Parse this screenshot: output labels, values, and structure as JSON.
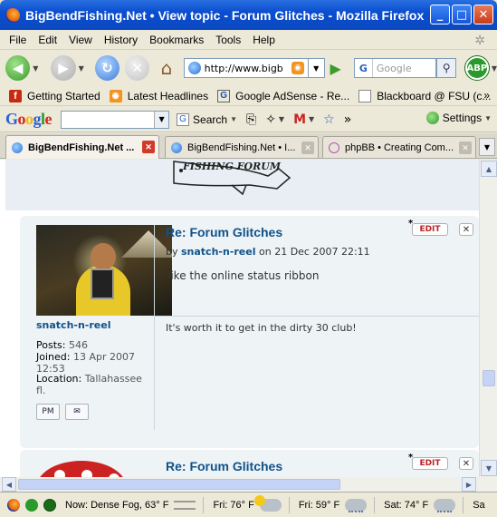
{
  "window": {
    "title": "BigBendFishing.Net • View topic - Forum Glitches - Mozilla Firefox",
    "buttons": [
      "_",
      "□",
      "✕"
    ]
  },
  "menu": [
    "File",
    "Edit",
    "View",
    "History",
    "Bookmarks",
    "Tools",
    "Help"
  ],
  "nav": {
    "url": "http://www.bigb",
    "search_placeholder": "Google",
    "abp": "ABP"
  },
  "bookmarks": {
    "items": [
      "Getting Started",
      "Latest Headlines",
      "Google AdSense - Re...",
      "Blackboard @ FSU (c..."
    ],
    "more": "»"
  },
  "google_toolbar": {
    "logo": "Google",
    "search_label": "Search",
    "more": "»",
    "settings_label": "Settings"
  },
  "tabs": [
    {
      "label": "BigBendFishing.Net ..."
    },
    {
      "label": "BigBendFishing.Net • I..."
    },
    {
      "label": "phpBB • Creating Com..."
    }
  ],
  "header": {
    "logo_text": "FISHING FORUM"
  },
  "post": {
    "title": "Re: Forum Glitches",
    "by_prefix": "by",
    "author": "snatch-n-reel",
    "date": "on 21 Dec 2007 22:11",
    "body": "like the online status ribbon",
    "signature": "It's worth it to get in the dirty 30 club!",
    "edit_label": "EDIT",
    "star": "*",
    "x_label": "✕",
    "profile": {
      "username": "snatch-n-reel",
      "posts_label": "Posts:",
      "posts": "546",
      "joined_label": "Joined:",
      "joined": "13 Apr 2007 12:53",
      "location_label": "Location:",
      "location": "Tallahassee fl.",
      "pm_label": "PM",
      "email_label": "✉"
    }
  },
  "post2": {
    "title": "Re: Forum Glitches",
    "edit_label": "EDIT",
    "star": "*",
    "x_label": "✕"
  },
  "status": [
    {
      "text": "Now: Dense Fog, 63° F"
    },
    {
      "text": "Fri: 76° F"
    },
    {
      "text": "Fri: 59° F"
    },
    {
      "text": "Sat: 74° F"
    },
    {
      "text": "Sa"
    }
  ]
}
